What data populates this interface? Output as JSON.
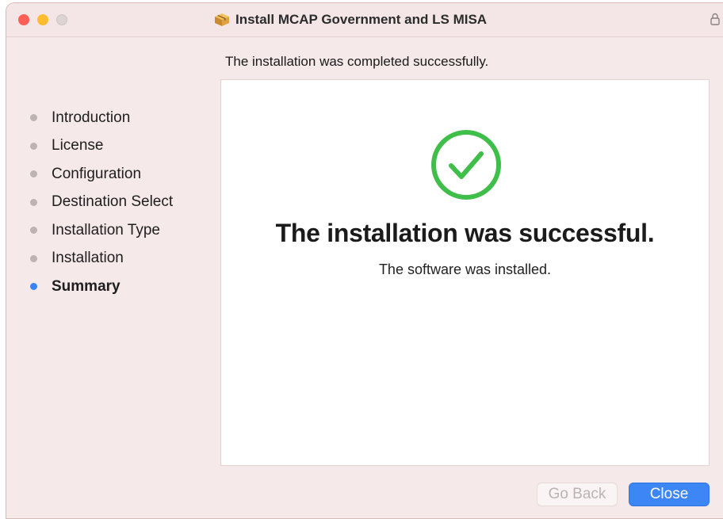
{
  "window": {
    "title": "Install MCAP Government and LS MISA"
  },
  "header": {
    "status_text": "The installation was completed successfully."
  },
  "sidebar": {
    "steps": [
      {
        "label": "Introduction",
        "active": false
      },
      {
        "label": "License",
        "active": false
      },
      {
        "label": "Configuration",
        "active": false
      },
      {
        "label": "Destination Select",
        "active": false
      },
      {
        "label": "Installation Type",
        "active": false
      },
      {
        "label": "Installation",
        "active": false
      },
      {
        "label": "Summary",
        "active": true
      }
    ]
  },
  "main": {
    "icon": "checkmark-circle-icon",
    "title": "The installation was successful.",
    "subtitle": "The software was installed."
  },
  "buttons": {
    "back_label": "Go Back",
    "close_label": "Close"
  },
  "colors": {
    "accent": "#3d86f5",
    "success": "#3fbe4a",
    "inactive_dot": "#bdb3b3"
  }
}
